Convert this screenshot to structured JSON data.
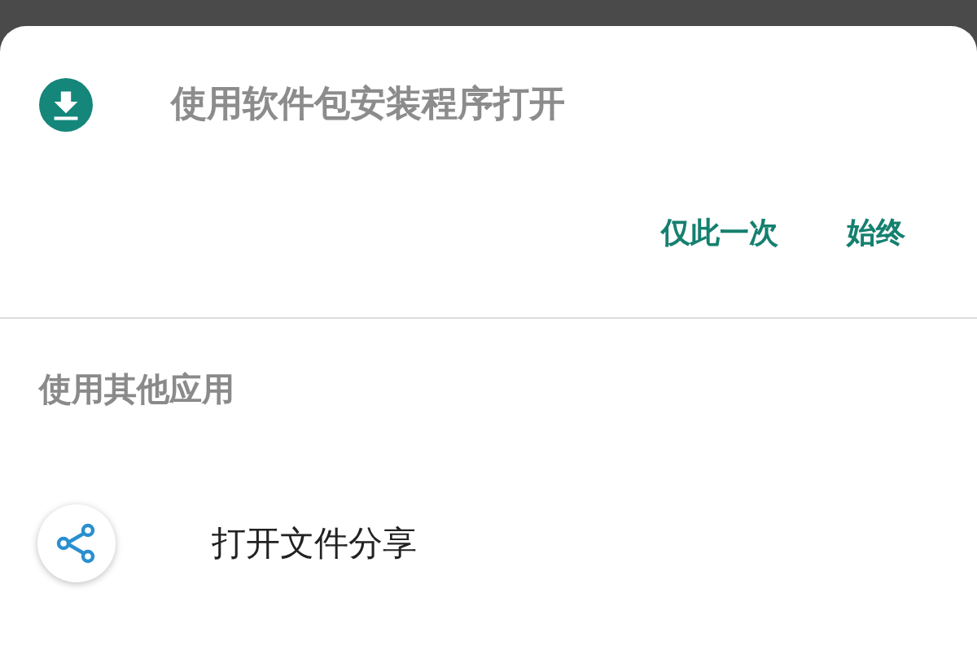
{
  "default_app": {
    "title": "使用软件包安装程序打开"
  },
  "buttons": [
    {
      "label": "仅此一次"
    },
    {
      "label": "始终"
    }
  ],
  "other_apps": {
    "heading": "使用其他应用",
    "items": [
      {
        "label": "打开文件分享"
      }
    ]
  }
}
